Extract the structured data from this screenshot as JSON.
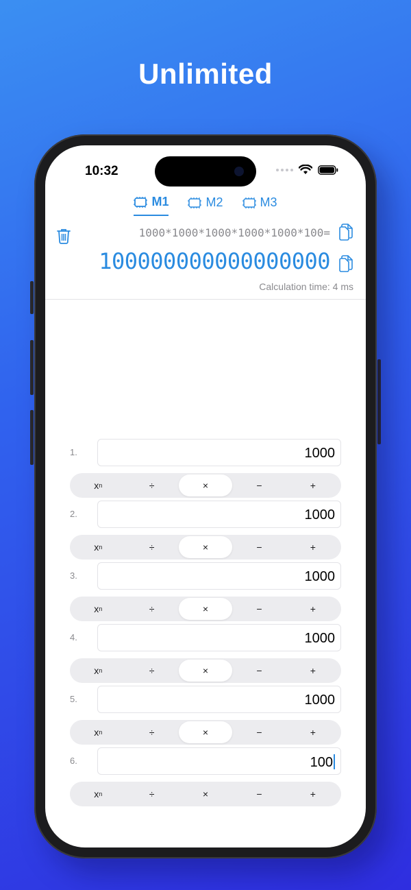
{
  "headline": "Unlimited",
  "status_bar": {
    "time": "10:32"
  },
  "tabs": [
    {
      "label": "M1",
      "active": true
    },
    {
      "label": "M2",
      "active": false
    },
    {
      "label": "M3",
      "active": false
    }
  ],
  "display": {
    "expression": "1000*1000*1000*1000*1000*100=",
    "result": "100000000000000000",
    "calculation_time": "Calculation time: 4 ms"
  },
  "operand_rows": [
    {
      "index": "1.",
      "value": "1000",
      "selected_op": "×",
      "has_caret": false
    },
    {
      "index": "2.",
      "value": "1000",
      "selected_op": "×",
      "has_caret": false
    },
    {
      "index": "3.",
      "value": "1000",
      "selected_op": "×",
      "has_caret": false
    },
    {
      "index": "4.",
      "value": "1000",
      "selected_op": "×",
      "has_caret": false
    },
    {
      "index": "5.",
      "value": "1000",
      "selected_op": "×",
      "has_caret": false
    },
    {
      "index": "6.",
      "value": "100",
      "selected_op": "",
      "has_caret": true
    }
  ],
  "operators": [
    "x",
    "÷",
    "×",
    "−",
    "+"
  ],
  "power_superscript": "n",
  "colors": {
    "accent": "#2a8be0",
    "background_top": "#3b8ff2",
    "background_bottom": "#2f2ee0"
  }
}
